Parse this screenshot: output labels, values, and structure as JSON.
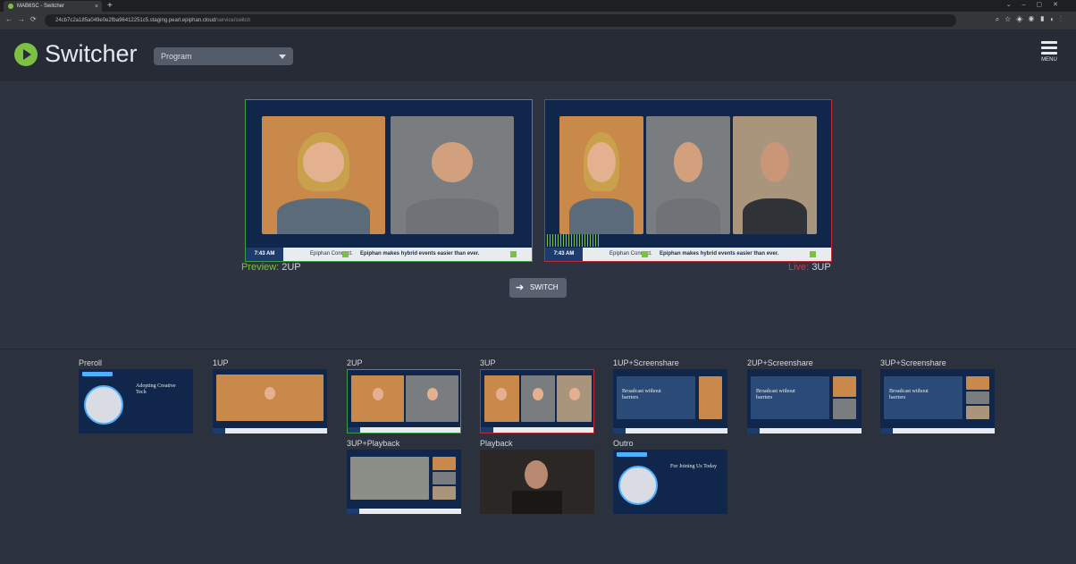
{
  "browser": {
    "tab_title": "MAB6SC - Switcher",
    "url_host": "24cb7c2a185a049e0e2fba96412251c5.staging.pearl.epiphan.cloud",
    "url_path": "/service/switch"
  },
  "header": {
    "app_title": "Switcher",
    "mode_select_value": "Program",
    "menu_label": "MENU"
  },
  "monitors": {
    "preview": {
      "label_key": "Preview:",
      "scene": "2UP"
    },
    "live": {
      "label_key": "Live:",
      "scene": "3UP"
    },
    "ticker_time": "7:43 AM",
    "ticker_msg_1": "Epiphan Connect.",
    "ticker_msg_2": "Epiphan makes hybrid events easier than ever."
  },
  "switch_label": "SWITCH",
  "scenes": [
    {
      "label": "Preroll",
      "kind": "slide",
      "text": "Adopting Creative Tech"
    },
    {
      "label": "1UP",
      "kind": "cams",
      "count": 1
    },
    {
      "label": "2UP",
      "kind": "cams",
      "count": 2,
      "state": "preview"
    },
    {
      "label": "3UP",
      "kind": "cams",
      "count": 3,
      "state": "live"
    },
    {
      "label": "1UP+Screenshare",
      "kind": "share",
      "count": 1,
      "text": "Broadcast without barriers"
    },
    {
      "label": "2UP+Screenshare",
      "kind": "share",
      "count": 2,
      "text": "Broadcast without barriers"
    },
    {
      "label": "3UP+Screenshare",
      "kind": "share",
      "count": 3,
      "text": "Broadcast without barriers"
    },
    {
      "label": "3UP+Playback",
      "kind": "playback"
    },
    {
      "label": "Playback",
      "kind": "video"
    },
    {
      "label": "Outro",
      "kind": "slide",
      "text": "For Joining Us Today"
    }
  ],
  "colors": {
    "accent_green": "#7cc242",
    "preview_green": "#3e9a44",
    "live_red": "#c22a35",
    "background": "#2d3340"
  }
}
